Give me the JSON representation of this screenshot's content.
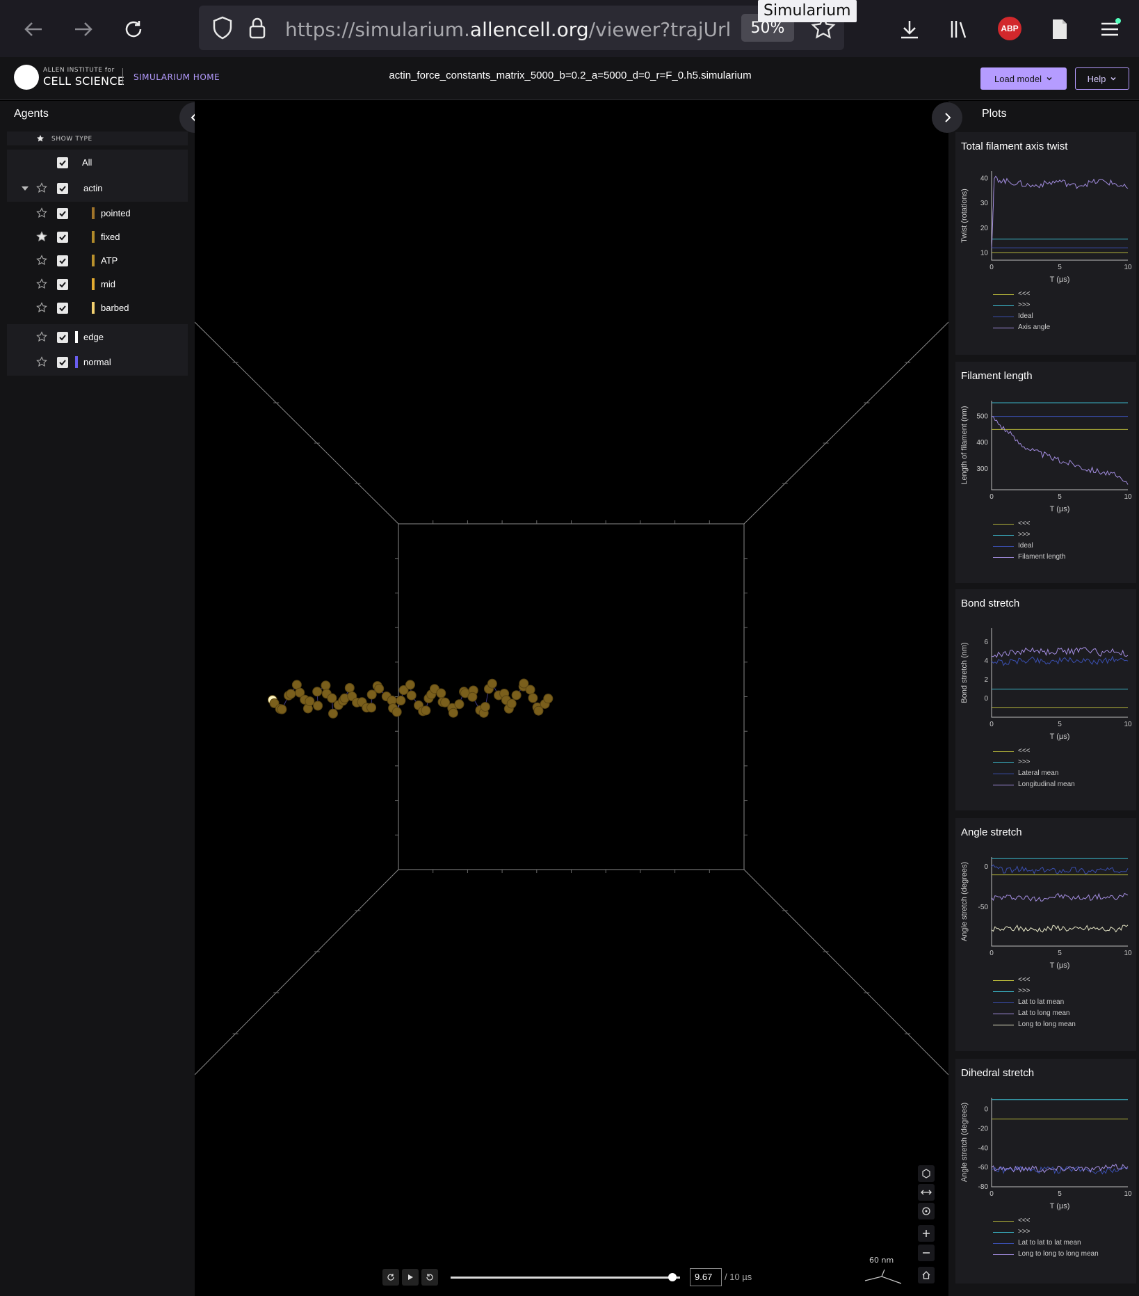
{
  "browser": {
    "url_prefix": "https://simularium.",
    "url_host": "allencell.org",
    "url_rest": "/viewer?trajUrl=http",
    "zoom": "50%",
    "tooltip": "Simularium",
    "abp_label": "ABP"
  },
  "header": {
    "logo_small": "ALLEN INSTITUTE for",
    "logo_big": "CELL SCIENCE",
    "home_link": "SIMULARIUM HOME",
    "file_title": "actin_force_constants_matrix_5000_b=0.2_a=5000_d=0_r=F_0.h5.simularium",
    "load_model": "Load model",
    "help": "Help",
    "accent": "#b59cff"
  },
  "agents_panel": {
    "title": "Agents",
    "show_type": "SHOW TYPE",
    "all_label": "All",
    "rows": [
      {
        "label": "actin",
        "starred": false,
        "color": "",
        "nested": false
      },
      {
        "label": "pointed",
        "starred": false,
        "color": "#a0742a",
        "nested": true
      },
      {
        "label": "fixed",
        "starred": true,
        "color": "#b08a2a",
        "nested": true
      },
      {
        "label": "ATP",
        "starred": false,
        "color": "#b8902c",
        "nested": true
      },
      {
        "label": "mid",
        "starred": false,
        "color": "#e2aa30",
        "nested": true
      },
      {
        "label": "barbed",
        "starred": false,
        "color": "#f2d070",
        "nested": true
      },
      {
        "label": "edge",
        "starred": false,
        "color": "#ffffff",
        "nested": false
      },
      {
        "label": "normal",
        "starred": false,
        "color": "#6a5ef0",
        "nested": false
      }
    ]
  },
  "playback": {
    "current_time": "9.67",
    "total_time": "/ 10 µs",
    "progress": 0.967,
    "scale_bar": "60 nm"
  },
  "plots_panel": {
    "title": "Plots",
    "plots": [
      {
        "title": "Total filament axis twist",
        "ylabel": "Twist (rotations)",
        "xlabel": "T (µs)",
        "xticks": [
          "0",
          "5",
          "10"
        ],
        "yticks": [
          "10",
          "20",
          "30",
          "40"
        ],
        "ylim": [
          7,
          43
        ],
        "legend": [
          {
            "label": "<<<",
            "color": "#b5b53a"
          },
          {
            "label": ">>>",
            "color": "#3ab5c8"
          },
          {
            "label": "Ideal",
            "color": "#3a4fb0"
          },
          {
            "label": "Axis angle",
            "color": "#a38de0"
          }
        ]
      },
      {
        "title": "Filament length",
        "ylabel": "Length of filament (nm)",
        "xlabel": "T (µs)",
        "xticks": [
          "0",
          "5",
          "10"
        ],
        "yticks": [
          "300",
          "400",
          "500"
        ],
        "ylim": [
          220,
          560
        ],
        "legend": [
          {
            "label": "<<<",
            "color": "#b5b53a"
          },
          {
            "label": ">>>",
            "color": "#3ab5c8"
          },
          {
            "label": "Ideal",
            "color": "#3a4fb0"
          },
          {
            "label": "Filament length",
            "color": "#a38de0"
          }
        ]
      },
      {
        "title": "Bond stretch",
        "ylabel": "Bond stretch (nm)",
        "xlabel": "T (µs)",
        "xticks": [
          "0",
          "5",
          "10"
        ],
        "yticks": [
          "0",
          "2",
          "4",
          "6"
        ],
        "ylim": [
          -2,
          7.5
        ],
        "legend": [
          {
            "label": "<<<",
            "color": "#b5b53a"
          },
          {
            "label": ">>>",
            "color": "#3ab5c8"
          },
          {
            "label": "Lateral mean",
            "color": "#3a4fb0"
          },
          {
            "label": "Longitudinal mean",
            "color": "#a38de0"
          }
        ]
      },
      {
        "title": "Angle stretch",
        "ylabel": "Angle stretch (degrees)",
        "xlabel": "T (µs)",
        "xticks": [
          "0",
          "5",
          "10"
        ],
        "yticks": [
          "-50",
          "0"
        ],
        "ylim": [
          -98,
          12
        ],
        "legend": [
          {
            "label": "<<<",
            "color": "#b5b53a"
          },
          {
            "label": ">>>",
            "color": "#3ab5c8"
          },
          {
            "label": "Lat to lat mean",
            "color": "#3a4fb0"
          },
          {
            "label": "Lat to long mean",
            "color": "#a38de0"
          },
          {
            "label": "Long to long mean",
            "color": "#e8e8c8"
          }
        ]
      },
      {
        "title": "Dihedral stretch",
        "ylabel": "Angle stretch (degrees)",
        "xlabel": "T (µs)",
        "xticks": [
          "0",
          "5",
          "10"
        ],
        "yticks": [
          "-80",
          "-60",
          "-40",
          "-20",
          "0"
        ],
        "ylim": [
          -80,
          12
        ],
        "legend": [
          {
            "label": "<<<",
            "color": "#b5b53a"
          },
          {
            "label": ">>>",
            "color": "#3ab5c8"
          },
          {
            "label": "Lat to lat to lat mean",
            "color": "#3a4fb0"
          },
          {
            "label": "Long to long to long mean",
            "color": "#a38de0"
          }
        ]
      }
    ]
  },
  "chart_data": [
    {
      "type": "line",
      "title": "Total filament axis twist",
      "xlabel": "T (µs)",
      "ylabel": "Twist (rotations)",
      "xlim": [
        0,
        10
      ],
      "ylim": [
        7,
        43
      ],
      "series": [
        {
          "name": "<<<",
          "x": [
            0,
            10
          ],
          "values": [
            10,
            10
          ]
        },
        {
          "name": ">>>",
          "x": [
            0,
            10
          ],
          "values": [
            15.5,
            15.5
          ]
        },
        {
          "name": "Ideal",
          "x": [
            0,
            10
          ],
          "values": [
            12,
            12
          ]
        },
        {
          "name": "Axis angle",
          "x": [
            0,
            0.2,
            1,
            2,
            3,
            4,
            5,
            6,
            7,
            8,
            9,
            10
          ],
          "values": [
            12,
            40,
            39,
            38,
            37,
            38,
            39,
            37,
            38,
            39,
            38,
            36
          ]
        }
      ]
    },
    {
      "type": "line",
      "title": "Filament length",
      "xlabel": "T (µs)",
      "ylabel": "Length of filament (nm)",
      "xlim": [
        0,
        10
      ],
      "ylim": [
        220,
        560
      ],
      "series": [
        {
          "name": "<<<",
          "x": [
            0,
            10
          ],
          "values": [
            450,
            450
          ]
        },
        {
          "name": ">>>",
          "x": [
            0,
            10
          ],
          "values": [
            552,
            552
          ]
        },
        {
          "name": "Ideal",
          "x": [
            0,
            10
          ],
          "values": [
            500,
            500
          ]
        },
        {
          "name": "Filament length",
          "x": [
            0,
            1,
            2,
            3,
            4,
            5,
            6,
            7,
            8,
            9,
            10
          ],
          "values": [
            500,
            450,
            400,
            370,
            350,
            330,
            320,
            300,
            290,
            275,
            240
          ]
        }
      ]
    },
    {
      "type": "line",
      "title": "Bond stretch",
      "xlabel": "T (µs)",
      "ylabel": "Bond stretch (nm)",
      "xlim": [
        0,
        10
      ],
      "ylim": [
        -2,
        7.5
      ],
      "series": [
        {
          "name": "<<<",
          "x": [
            0,
            10
          ],
          "values": [
            -1,
            -1
          ]
        },
        {
          "name": ">>>",
          "x": [
            0,
            10
          ],
          "values": [
            1,
            1
          ]
        },
        {
          "name": "Lateral mean",
          "x": [
            0,
            1,
            2,
            3,
            4,
            5,
            6,
            7,
            8,
            9,
            10
          ],
          "values": [
            4,
            3.8,
            4,
            4.2,
            3.9,
            4,
            4.1,
            3.9,
            4,
            4.2,
            4
          ]
        },
        {
          "name": "Longitudinal mean",
          "x": [
            0,
            1,
            2,
            3,
            4,
            5,
            6,
            7,
            8,
            9,
            10
          ],
          "values": [
            4.5,
            4.8,
            5,
            5.2,
            4.9,
            5.1,
            5,
            5.3,
            4.8,
            5.1,
            4.6
          ]
        }
      ]
    },
    {
      "type": "line",
      "title": "Angle stretch",
      "xlabel": "T (µs)",
      "ylabel": "Angle stretch (degrees)",
      "xlim": [
        0,
        10
      ],
      "ylim": [
        -98,
        12
      ],
      "series": [
        {
          "name": "<<<",
          "x": [
            0,
            10
          ],
          "values": [
            -10,
            -10
          ]
        },
        {
          "name": ">>>",
          "x": [
            0,
            10
          ],
          "values": [
            10,
            10
          ]
        },
        {
          "name": "Lat to lat mean",
          "x": [
            0,
            1,
            2,
            3,
            4,
            5,
            6,
            7,
            8,
            9,
            10
          ],
          "values": [
            0,
            -5,
            -3,
            -6,
            -4,
            -5,
            -3,
            -6,
            -4,
            -5,
            -2
          ]
        },
        {
          "name": "Lat to long mean",
          "x": [
            0,
            1,
            2,
            3,
            4,
            5,
            6,
            7,
            8,
            9,
            10
          ],
          "values": [
            -38,
            -38,
            -37,
            -40,
            -38,
            -36,
            -39,
            -38,
            -37,
            -39,
            -35
          ]
        },
        {
          "name": "Long to long mean",
          "x": [
            0,
            1,
            2,
            3,
            4,
            5,
            6,
            7,
            8,
            9,
            10
          ],
          "values": [
            -78,
            -77,
            -76,
            -78,
            -77,
            -75,
            -78,
            -76,
            -77,
            -78,
            -72
          ]
        }
      ]
    },
    {
      "type": "line",
      "title": "Dihedral stretch",
      "xlabel": "T (µs)",
      "ylabel": "Angle stretch (degrees)",
      "xlim": [
        0,
        10
      ],
      "ylim": [
        -80,
        12
      ],
      "series": [
        {
          "name": "<<<",
          "x": [
            0,
            10
          ],
          "values": [
            -10,
            -10
          ]
        },
        {
          "name": ">>>",
          "x": [
            0,
            10
          ],
          "values": [
            10,
            10
          ]
        },
        {
          "name": "Lat to lat to lat mean",
          "x": [
            0,
            1,
            2,
            3,
            4,
            5,
            6,
            7,
            8,
            9,
            10
          ],
          "values": [
            -62,
            -63,
            -61,
            -64,
            -62,
            -63,
            -61,
            -62,
            -64,
            -62,
            -61
          ]
        },
        {
          "name": "Long to long to long mean",
          "x": [
            0,
            1,
            2,
            3,
            4,
            5,
            6,
            7,
            8,
            9,
            10
          ],
          "values": [
            -60,
            -61,
            -62,
            -60,
            -63,
            -61,
            -60,
            -62,
            -61,
            -60,
            -59
          ]
        }
      ]
    }
  ]
}
